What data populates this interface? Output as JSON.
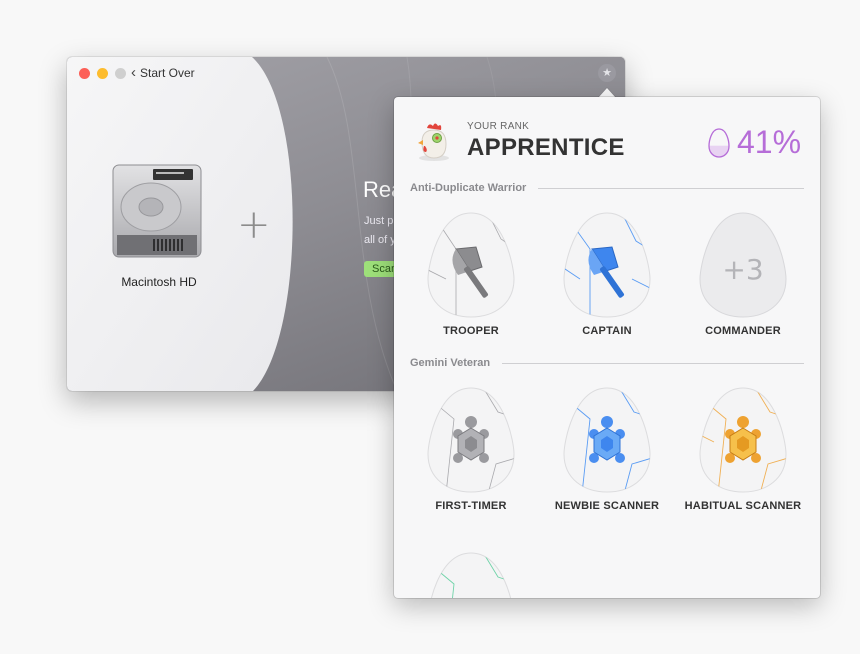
{
  "window": {
    "back_label": "Start Over",
    "disk_name": "Macintosh HD",
    "ready_title": "Rea",
    "ready_line1": "Just p",
    "ready_line2": "all of y",
    "scan_button": "Scan",
    "accent_green": "#9ee07a"
  },
  "rank": {
    "caption": "YOUR RANK",
    "name": "APPRENTICE",
    "percent_text": "41%",
    "progress": 0.41,
    "accent": "#b66dd8"
  },
  "sections": [
    {
      "title": "Anti-Duplicate Warrior",
      "badges": [
        {
          "label": "TROOPER",
          "icon": "axe-icon",
          "color": "#8c8c8c"
        },
        {
          "label": "CAPTAIN",
          "icon": "axe-icon",
          "color": "#4a8ef0"
        },
        {
          "label": "COMMANDER",
          "icon": "locked-egg-icon",
          "more": "+3"
        }
      ]
    },
    {
      "title": "Gemini Veteran",
      "badges": [
        {
          "label": "FIRST-TIMER",
          "icon": "turtle-icon",
          "color": "#8c8c8c"
        },
        {
          "label": "NEWBIE SCANNER",
          "icon": "turtle-icon",
          "color": "#4a8ef0"
        },
        {
          "label": "HABITUAL SCANNER",
          "icon": "turtle-icon",
          "color": "#f0a932"
        }
      ]
    }
  ]
}
